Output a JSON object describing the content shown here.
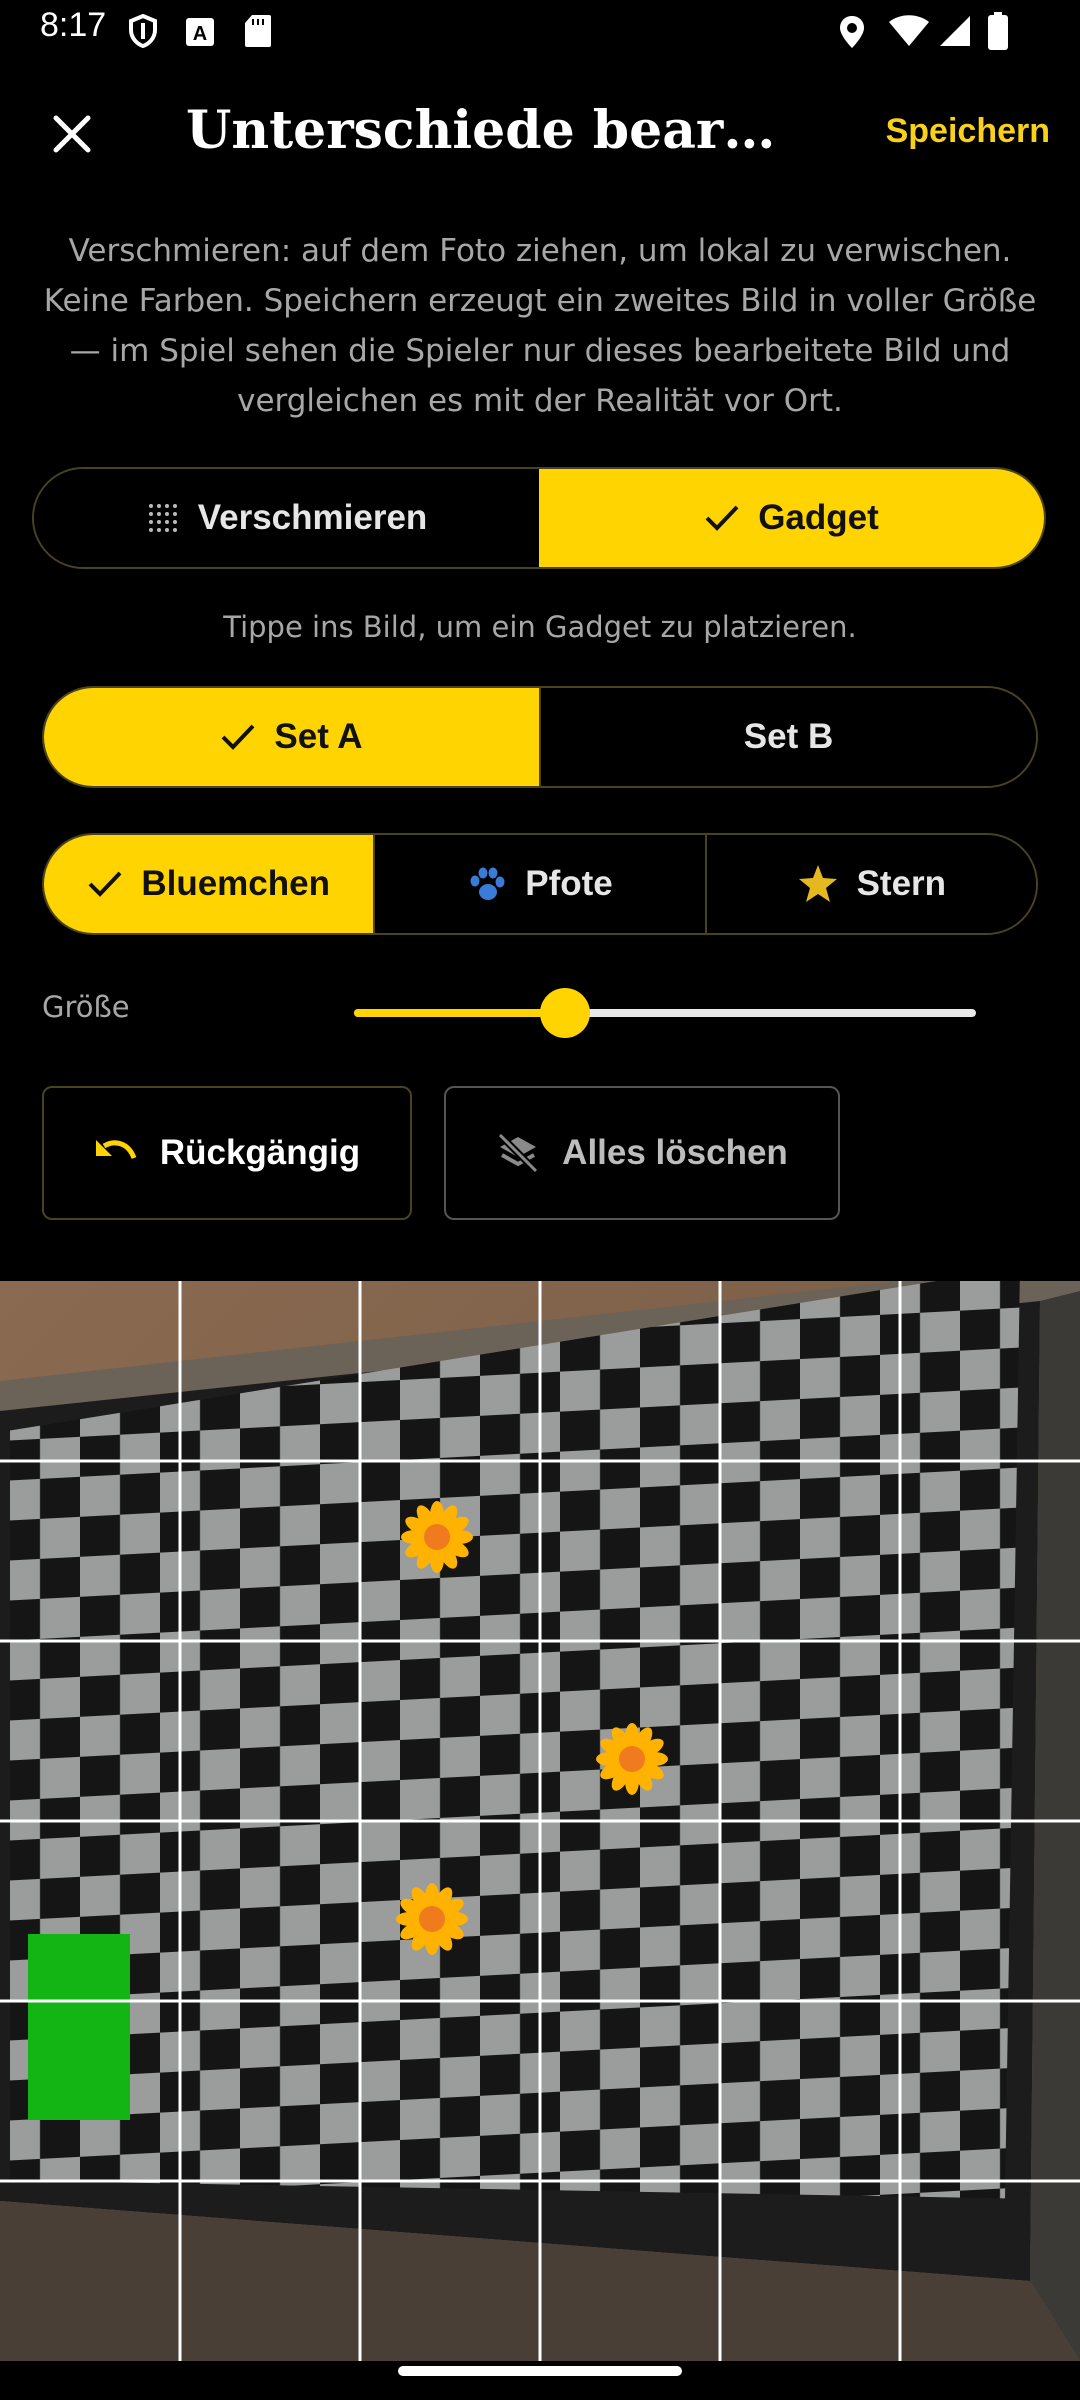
{
  "status_bar": {
    "time": "8:17",
    "left_icons": [
      "shield-icon",
      "text-a-icon",
      "sd-card-icon"
    ],
    "right_icons": [
      "location-icon",
      "wifi-icon",
      "signal-icon",
      "battery-icon"
    ]
  },
  "app_bar": {
    "title": "Unterschiede bearbeiten",
    "save_label": "Speichern",
    "close_icon": "close-icon"
  },
  "help_text": "Verschmieren: auf dem Foto ziehen, um lokal zu verwischen. Keine Farben. Speichern erzeugt ein zweites Bild in voller Größe — im Spiel sehen die Spieler nur dieses bearbeitete Bild und vergleichen es mit der Realität vor Ort.",
  "mode_toggle": {
    "options": [
      {
        "label": "Verschmieren",
        "icon": "smudge-dots-icon",
        "selected": false
      },
      {
        "label": "Gadget",
        "icon": "check-icon",
        "selected": true
      }
    ]
  },
  "gadget_hint": "Tippe ins Bild, um ein Gadget zu platzieren.",
  "set_toggle": {
    "options": [
      {
        "label": "Set A",
        "selected": true
      },
      {
        "label": "Set B",
        "selected": false
      }
    ]
  },
  "gadget_toggle": {
    "options": [
      {
        "label": "Bluemchen",
        "icon": "check-icon",
        "selected": true
      },
      {
        "label": "Pfote",
        "icon": "paw-icon",
        "selected": false
      },
      {
        "label": "Stern",
        "icon": "star-icon",
        "selected": false
      }
    ]
  },
  "size": {
    "label": "Größe",
    "value_fraction": 0.34
  },
  "actions": {
    "undo_label": "Rückgängig",
    "clear_label": "Alles löschen"
  },
  "photo": {
    "grid": "6x6",
    "placed_gadgets": [
      "flower-icon",
      "flower-icon",
      "flower-icon"
    ]
  },
  "colors": {
    "accent": "#FFD400",
    "save_text": "#F9D11B",
    "background": "#000000",
    "secondary_text": "#A7A7A7",
    "border": "#4A4220"
  }
}
